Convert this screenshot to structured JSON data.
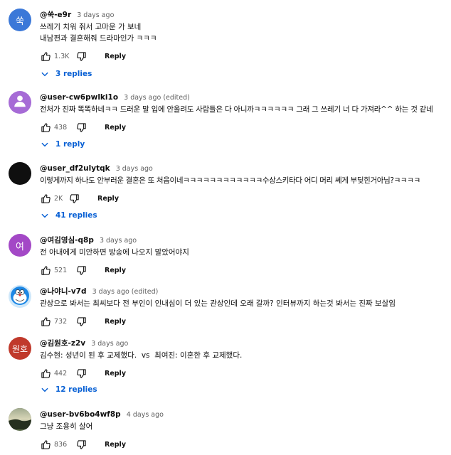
{
  "labels": {
    "reply": "Reply"
  },
  "comments": [
    {
      "author": "@쑥-e9r",
      "time": "3 days ago",
      "avatar_text": "쑥",
      "avatar_color": "#3b78d8",
      "lines": [
        "쓰레기 치워 줘서 고마운 가 보네",
        "내남편과  결혼해줘 드라마인가 ㅋㅋㅋ"
      ],
      "likes": "1.3K",
      "replies": "3 replies"
    },
    {
      "author": "@user-cw6pwlki1o",
      "time": "3 days ago (edited)",
      "avatar_text": "",
      "avatar_icon": "default-user-icon",
      "avatar_color": "#a66bd6",
      "lines": [
        "전처가 진짜 똑똑하네ㅋㅋ 드러운 말 입에 안올려도 사람들은 다 아니까ㅋㅋㅋㅋㅋㅋ 그래 그 쓰레기 너 다 가져라^^ 하는 것 같네"
      ],
      "likes": "438",
      "replies": "1 reply"
    },
    {
      "author": "@user_df2ulytqk",
      "time": "3 days ago",
      "avatar_text": "",
      "avatar_color": "#0f0f0f",
      "lines": [
        "이렇게까지 하나도 안부러운 결혼은 또 처음이네ㅋㅋㅋㅋㅋㅋㅋㅋㅋㅋㅋㅋ수상스키타다 어디 머리 쎄게 부딪힌거아님?ㅋㅋㅋㅋ"
      ],
      "likes": "2K",
      "replies": "41 replies"
    },
    {
      "author": "@여김영심-q8p",
      "time": "3 days ago",
      "avatar_text": "여",
      "avatar_color": "#a348c6",
      "lines": [
        "전 아내에게 미안하면 방송에 나오지 말았어야지"
      ],
      "likes": "521",
      "replies": ""
    },
    {
      "author": "@나야니-v7d",
      "time": "3 days ago (edited)",
      "avatar_text": "",
      "avatar_icon": "doraemon-avatar-icon",
      "avatar_color": "#cfe8fa",
      "lines": [
        "관상으로 봐서는 최씨보다 전 부인이 인내심이 더 있는 관상인데 오래 갈까? 인터뷰까지 하는것 봐서는 진짜 보살임"
      ],
      "likes": "732",
      "replies": ""
    },
    {
      "author": "@김원호-z2v",
      "time": "3 days ago",
      "avatar_text": "원호",
      "avatar_color": "#c0392b",
      "lines": [
        "김수현: 성년이 된 후 교제했다.  vs  최여진: 이혼한 후 교제했다."
      ],
      "likes": "442",
      "replies": "12 replies"
    },
    {
      "author": "@user-bv6bo4wf8p",
      "time": "4 days ago",
      "avatar_text": "",
      "avatar_icon": "landscape-avatar-icon",
      "avatar_color": "#5b6b4a",
      "lines": [
        "그냥 조용히 살어"
      ],
      "likes": "836",
      "replies": ""
    }
  ]
}
